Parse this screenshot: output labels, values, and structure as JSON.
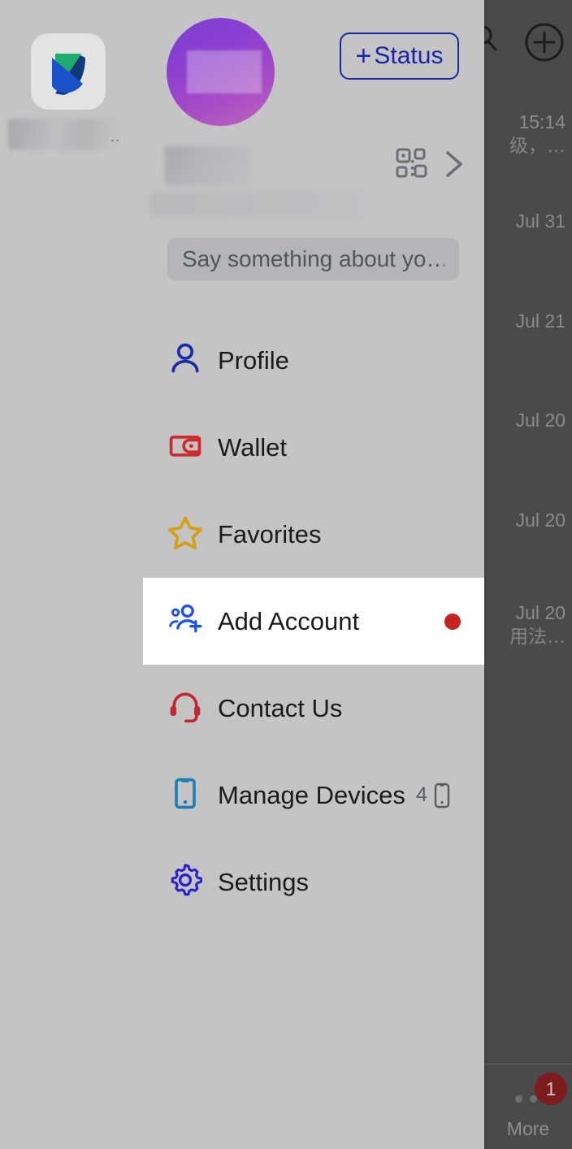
{
  "app_rail": {
    "app_icon_name": "messenger-app-icon",
    "app_label_redacted": true,
    "ellipsis": ".."
  },
  "drawer": {
    "avatar": {
      "name": "user-avatar",
      "redacted": true
    },
    "status_button": {
      "plus": "+",
      "label": "Status"
    },
    "profile_name_redacted": true,
    "profile_subtitle_redacted": true,
    "qr_icon": "qr-code-icon",
    "chevron_icon": "chevron-right-icon",
    "status_input": {
      "value": "",
      "placeholder": "Say something about yo…"
    },
    "menu": [
      {
        "id": "profile",
        "label": "Profile",
        "icon": "person-icon",
        "icon_color": "#1b2aa8",
        "active": false,
        "dot": false,
        "meta": null
      },
      {
        "id": "wallet",
        "label": "Wallet",
        "icon": "wallet-icon",
        "icon_color": "#cf2a2a",
        "active": false,
        "dot": false,
        "meta": null
      },
      {
        "id": "favorites",
        "label": "Favorites",
        "icon": "star-icon",
        "icon_color": "#d4a017",
        "active": false,
        "dot": false,
        "meta": null
      },
      {
        "id": "add-account",
        "label": "Add Account",
        "icon": "add-account-icon",
        "icon_color": "#1b4ff0",
        "active": true,
        "dot": true,
        "meta": null
      },
      {
        "id": "contact-us",
        "label": "Contact Us",
        "icon": "headset-icon",
        "icon_color": "#c0292f",
        "active": false,
        "dot": false,
        "meta": null
      },
      {
        "id": "manage-devices",
        "label": "Manage Devices",
        "icon": "phone-icon",
        "icon_color": "#1a7fb5",
        "active": false,
        "dot": false,
        "meta": "4"
      },
      {
        "id": "settings",
        "label": "Settings",
        "icon": "gear-icon",
        "icon_color": "#2a23c9",
        "active": false,
        "dot": false,
        "meta": null
      }
    ]
  },
  "background": {
    "search_icon": "search-icon",
    "add_icon": "plus-circle-icon",
    "rows": [
      {
        "date": "15:14",
        "snippet": "级，…"
      },
      {
        "date": "Jul 31",
        "snippet": ""
      },
      {
        "date": "Jul 21",
        "snippet": ""
      },
      {
        "date": "Jul 20",
        "snippet": ""
      },
      {
        "date": "Jul 20",
        "snippet": ""
      },
      {
        "date": "Jul 20",
        "snippet": "用法…"
      }
    ],
    "tabbar": {
      "more_label": "More",
      "more_badge": "1"
    }
  },
  "colors": {
    "drawer_bg": "#c4c4c4",
    "active_row_bg": "#ffffff",
    "accent_blue": "#1b26a6",
    "red_dot": "#c62222",
    "dimmed_bg": "#4a4a4a"
  }
}
